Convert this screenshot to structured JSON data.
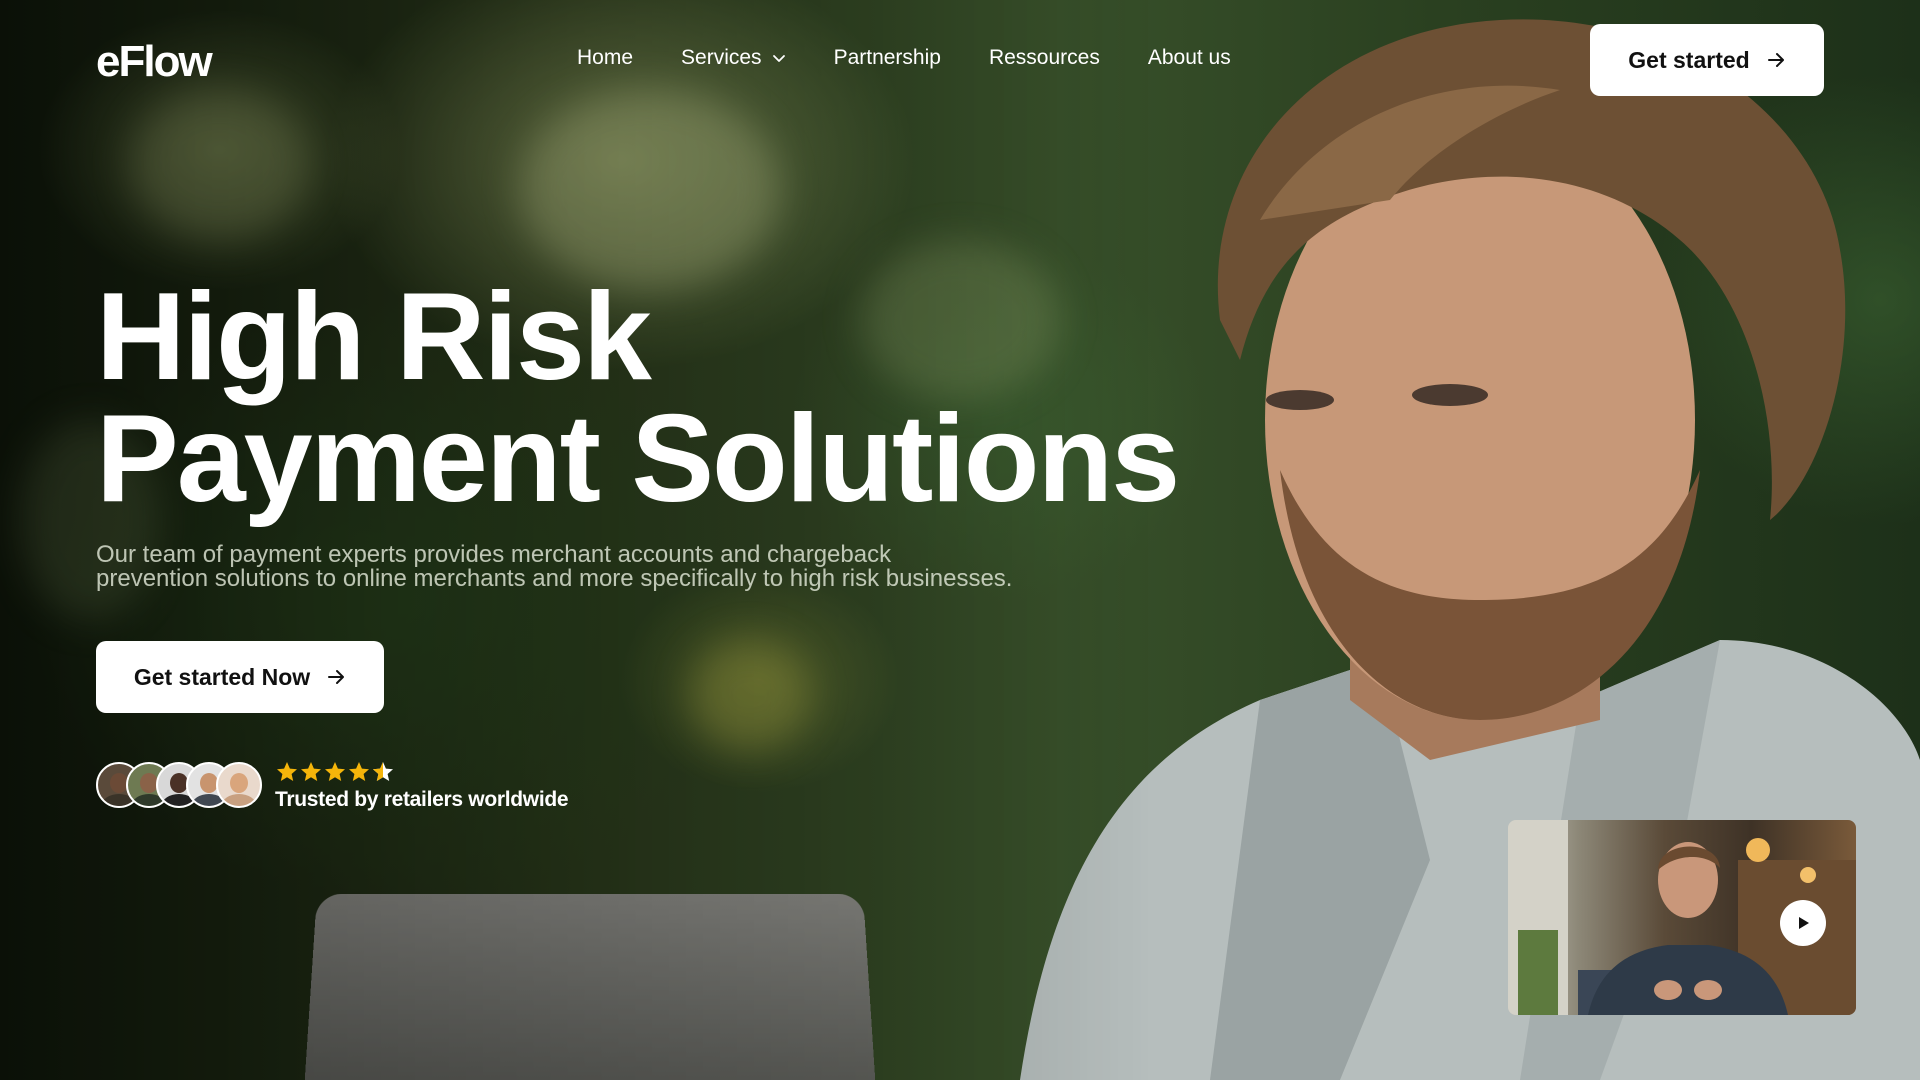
{
  "brand": {
    "logo_text": "eFlow"
  },
  "nav": {
    "items": [
      {
        "label": "Home"
      },
      {
        "label": "Services",
        "has_dropdown": true
      },
      {
        "label": "Partnership"
      },
      {
        "label": "Ressources"
      },
      {
        "label": "About us"
      }
    ],
    "cta_label": "Get started"
  },
  "hero": {
    "headline_line1": "High Risk",
    "headline_line2": "Payment Solutions",
    "subtext_line1": "Our team of payment experts provides merchant accounts and chargeback",
    "subtext_line2": "prevention solutions to online merchants and more specifically to high risk businesses.",
    "cta_label": "Get started Now"
  },
  "social_proof": {
    "avatar_count": 5,
    "rating_stars": 4.5,
    "rating_max": 5,
    "trust_text": "Trusted by retailers worldwide"
  },
  "video": {
    "play_icon": "play-icon"
  },
  "colors": {
    "accent_star": "#f5b50a",
    "button_bg": "#ffffff",
    "button_text": "#111111"
  }
}
